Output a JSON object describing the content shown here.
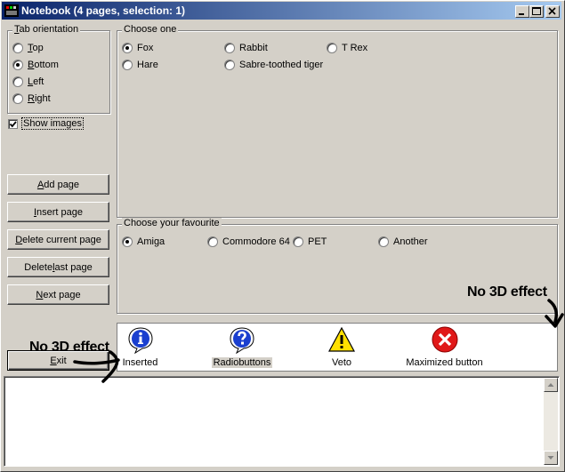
{
  "window": {
    "title": "Notebook (4 pages, selection: 1)"
  },
  "tab_orientation": {
    "label": "Tab orientation",
    "options": [
      {
        "accel": "T",
        "rest": "op",
        "selected": false
      },
      {
        "accel": "B",
        "rest": "ottom",
        "selected": true
      },
      {
        "accel": "L",
        "rest": "eft",
        "selected": false
      },
      {
        "accel": "R",
        "rest": "ight",
        "selected": false
      }
    ]
  },
  "show_images": {
    "label": "Show images",
    "checked": true
  },
  "buttons": {
    "add_page": {
      "accel": "A",
      "rest": "dd page"
    },
    "insert_page": {
      "accel": "I",
      "rest": "nsert page"
    },
    "delete_current": {
      "accel": "D",
      "rest": "elete current page"
    },
    "delete_last": {
      "pre": "Delete ",
      "accel": "l",
      "rest": "ast page"
    },
    "next_page": {
      "accel": "N",
      "rest": "ext page"
    },
    "exit": {
      "accel": "E",
      "rest": "xit"
    }
  },
  "choose_one": {
    "label": "Choose one",
    "options": [
      "Fox",
      "Rabbit",
      "T Rex",
      "Hare",
      "Sabre-toothed tiger"
    ],
    "selected": "Fox"
  },
  "choose_favourite": {
    "label": "Choose your favourite",
    "options": [
      "Amiga",
      "Commodore 64",
      "PET",
      "Another"
    ],
    "selected": "Amiga"
  },
  "notebook_tabs": [
    {
      "label": "Inserted",
      "icon": "information-icon",
      "selected": false
    },
    {
      "label": "Radiobuttons",
      "icon": "question-icon",
      "selected": true
    },
    {
      "label": "Veto",
      "icon": "warning-icon",
      "selected": false
    },
    {
      "label": "Maximized button",
      "icon": "error-icon",
      "selected": false
    }
  ],
  "annotations": {
    "top_right": "No 3D effect",
    "left": "No 3D effect"
  },
  "colors": {
    "face": "#d4d0c8",
    "titlebar_start": "#0a246a",
    "titlebar_end": "#a6caf0",
    "info_blue": "#1a3fcf",
    "warning_yellow": "#ffe000",
    "error_red": "#e01818"
  }
}
